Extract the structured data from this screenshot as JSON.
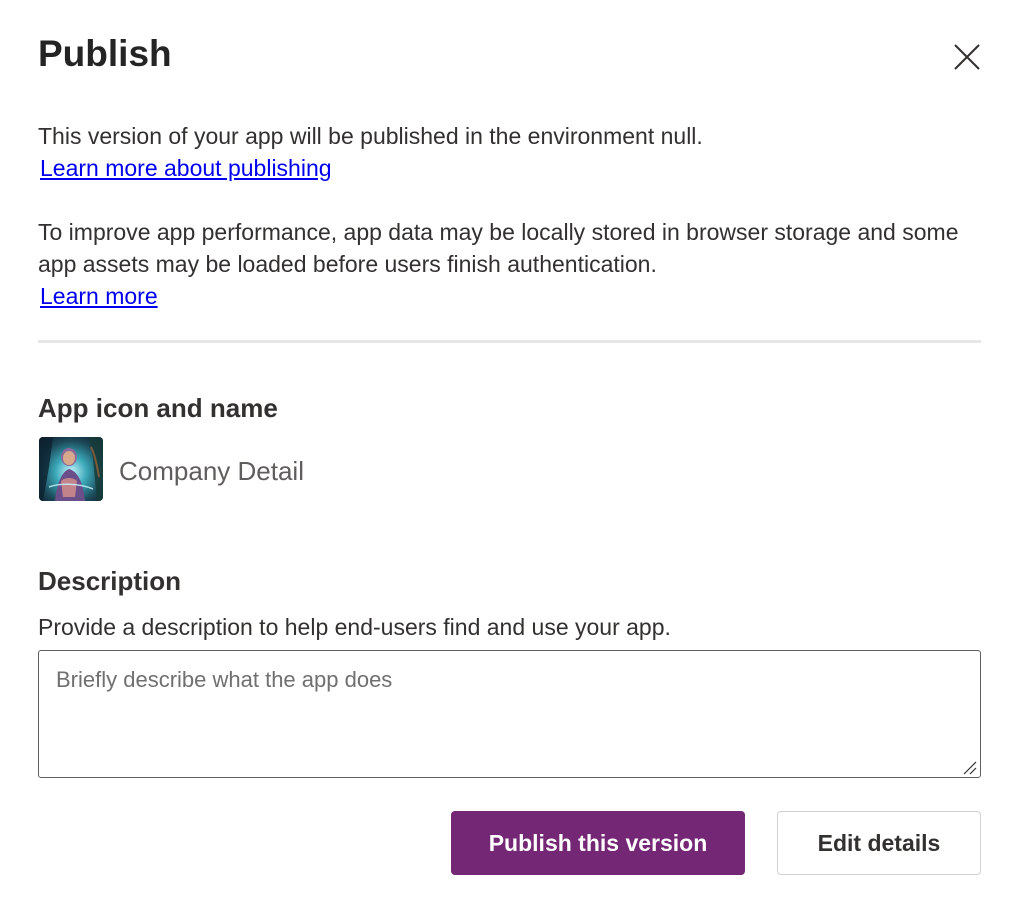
{
  "dialog": {
    "title": "Publish",
    "close_icon": "close-icon",
    "intro_text": "This version of your app will be published in the environment null.",
    "learn_publishing_link": "Learn more about publishing",
    "performance_text": "To improve app performance, app data may be locally stored in browser storage and some app assets may be loaded before users finish authentication.",
    "learn_more_link": "Learn more"
  },
  "app_section": {
    "heading": "App icon and name",
    "icon": "app-icon-image",
    "app_name": "Company Detail"
  },
  "description_section": {
    "heading": "Description",
    "helper_text": "Provide a description to help end-users find and use your app.",
    "placeholder": "Briefly describe what the app does",
    "value": ""
  },
  "actions": {
    "publish_label": "Publish this version",
    "edit_label": "Edit details"
  },
  "colors": {
    "primary_button": "#742774",
    "link": "#0000ee",
    "text": "#323130",
    "divider": "#e6e6e6"
  }
}
